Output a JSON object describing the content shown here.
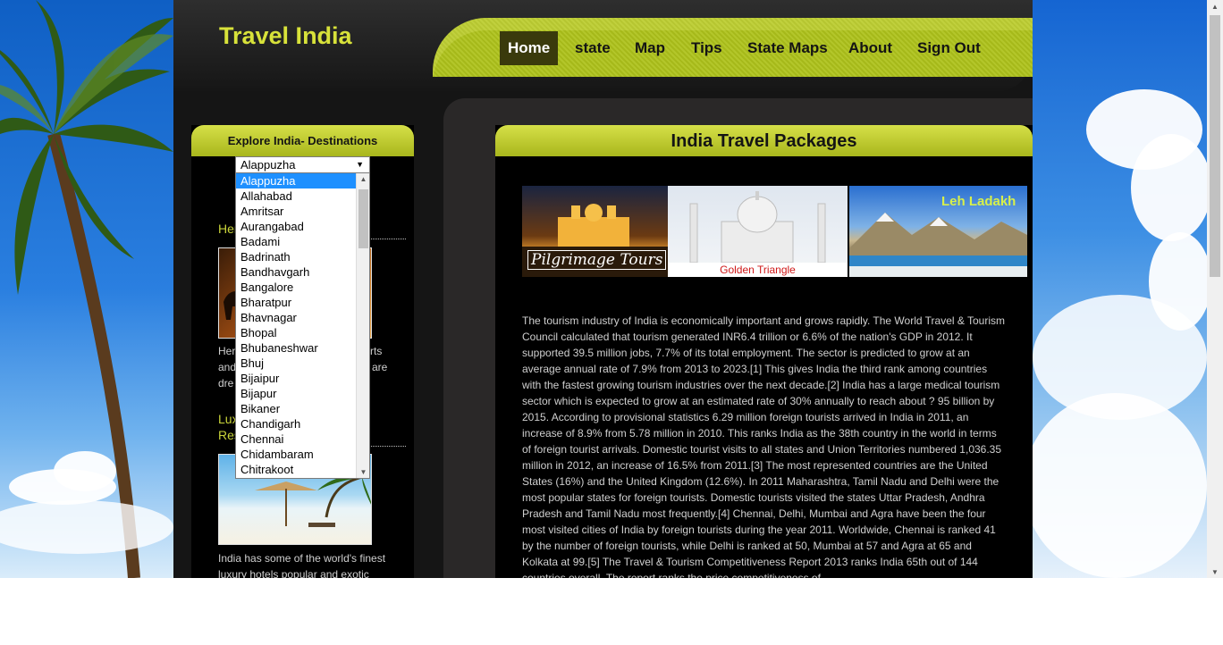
{
  "site": {
    "logo": "Travel India"
  },
  "nav": [
    {
      "label": "Home",
      "active": true
    },
    {
      "label": "state"
    },
    {
      "label": "Map"
    },
    {
      "label": "Tips"
    },
    {
      "label": "State Maps"
    },
    {
      "label": "About"
    },
    {
      "label": "Sign Out"
    }
  ],
  "sidebar": {
    "heading": "Explore India- Destinations",
    "select": {
      "value": "Alappuzha",
      "options": [
        "Alappuzha",
        "Allahabad",
        "Amritsar",
        "Aurangabad",
        "Badami",
        "Badrinath",
        "Bandhavgarh",
        "Bangalore",
        "Bharatpur",
        "Bhavnagar",
        "Bhopal",
        "Bhubaneshwar",
        "Bhuj",
        "Bijaipur",
        "Bijapur",
        "Bikaner",
        "Chandigarh",
        "Chennai",
        "Chidambaram",
        "Chitrakoot"
      ]
    },
    "section1": {
      "title": "Her",
      "text": [
        "Her",
        "rts",
        "and",
        "are",
        "dre"
      ]
    },
    "section2": {
      "title_line1": "Lux",
      "title_line2": "Res"
    },
    "section2_text": "India has some of the world's finest luxury hotels popular and exotic"
  },
  "main": {
    "heading": "India Travel Packages",
    "banners": [
      {
        "caption": "Pilgrimage Tours"
      },
      {
        "caption": "Golden Triangle"
      },
      {
        "caption": "Leh Ladakh"
      }
    ],
    "paragraph": "The tourism industry of India is economically important and grows rapidly. The World Travel & Tourism Council calculated that tourism generated INR6.4 trillion or 6.6% of the nation's GDP in 2012. It supported 39.5 million jobs, 7.7% of its total employment. The sector is predicted to grow at an average annual rate of 7.9% from 2013 to 2023.[1] This gives India the third rank among countries with the fastest growing tourism industries over the next decade.[2] India has a large medical tourism sector which is expected to grow at an estimated rate of 30% annually to reach about ? 95 billion by 2015. According to provisional statistics 6.29 million foreign tourists arrived in India in 2011, an increase of 8.9% from 5.78 million in 2010. This ranks India as the 38th country in the world in terms of foreign tourist arrivals. Domestic tourist visits to all states and Union Territories numbered 1,036.35 million in 2012, an increase of 16.5% from 2011.[3] The most represented countries are the United States (16%) and the United Kingdom (12.6%). In 2011 Maharashtra, Tamil Nadu and Delhi were the most popular states for foreign tourists. Domestic tourists visited the states Uttar Pradesh, Andhra Pradesh and Tamil Nadu most frequently.[4] Chennai, Delhi, Mumbai and Agra have been the four most visited cities of India by foreign tourists during the year 2011. Worldwide, Chennai is ranked 41 by the number of foreign tourists, while Delhi is ranked at 50, Mumbai at 57 and Agra at 65 and Kolkata at 99.[5] The Travel & Tourism Competitiveness Report 2013 ranks India 65th out of 144 countries overall. The report ranks the price competitiveness of"
  },
  "colors": {
    "accent": "#c9d43a",
    "nav_active": "#3a3a0c",
    "select_highlight": "#1e90ff"
  }
}
